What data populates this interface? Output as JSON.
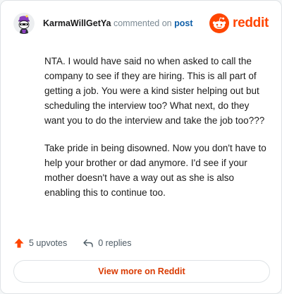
{
  "header": {
    "username": "KarmaWillGetYa",
    "action_text": "commented on",
    "post_link_label": "post",
    "avatar_icon": "snoo-avatar-icon",
    "brand_icon": "reddit-logo-icon",
    "brand_word": "reddit"
  },
  "comment": {
    "paragraphs": [
      "NTA. I would have said no when asked to call the company to see if they are hiring. This is all part of getting a job. You were a kind sister helping out but scheduling the interview too? What next, do they want you to do the interview and take the job too???",
      "Take pride in being disowned. Now you don't have to help your brother or dad anymore. I'd see if your mother doesn't have a way out as she is also enabling this to continue too."
    ]
  },
  "stats": {
    "upvotes_label": "5 upvotes",
    "replies_label": "0 replies",
    "upvote_icon": "upvote-arrow-icon",
    "reply_icon": "reply-arrow-icon"
  },
  "footer": {
    "view_more_label": "View more on Reddit"
  },
  "colors": {
    "brand_orange": "#ff4500",
    "link_blue": "#0f5fa8",
    "muted": "#7c8a94",
    "button_text": "#d93a00"
  }
}
